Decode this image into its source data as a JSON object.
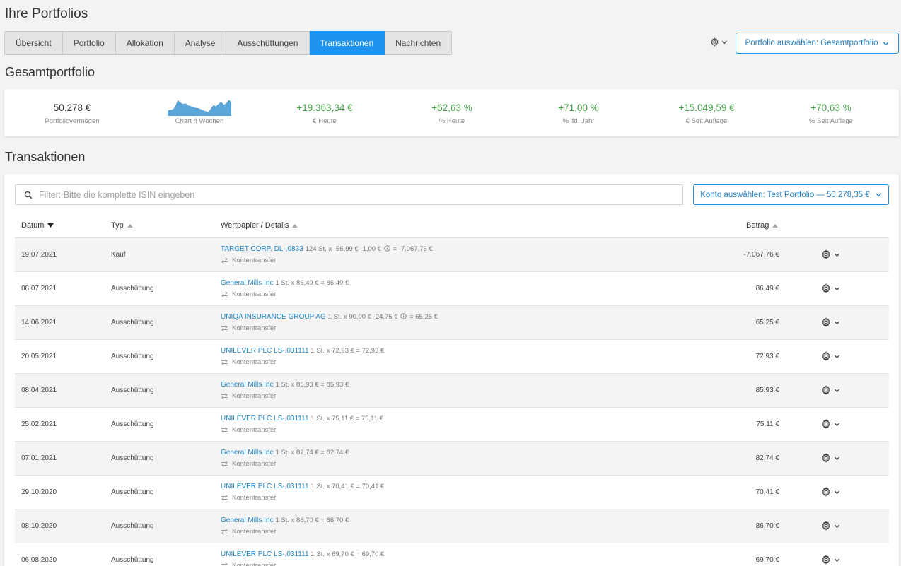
{
  "page": {
    "title": "Ihre Portfolios"
  },
  "tabs": [
    {
      "label": "Übersicht",
      "active": false
    },
    {
      "label": "Portfolio",
      "active": false
    },
    {
      "label": "Allokation",
      "active": false
    },
    {
      "label": "Analyse",
      "active": false
    },
    {
      "label": "Ausschüttungen",
      "active": false
    },
    {
      "label": "Transaktionen",
      "active": true
    },
    {
      "label": "Nachrichten",
      "active": false
    }
  ],
  "portfolio_select": {
    "label": "Portfolio auswählen: Gesamtportfolio"
  },
  "summary": {
    "title": "Gesamtportfolio",
    "value": "50.278 €",
    "value_label": "Portfoliovermögen",
    "chart_label": "Chart 4 Wochen",
    "kpis": [
      {
        "value": "+19.363,34  €",
        "label": "€ Heute"
      },
      {
        "value": "+62,63 %",
        "label": "% Heute"
      },
      {
        "value": "+71,00 %",
        "label": "% lfd. Jahr"
      },
      {
        "value": "+15.049,59  €",
        "label": "€ Seit Auflage"
      },
      {
        "value": "+70,63 %",
        "label": "% Seit Auflage"
      }
    ],
    "mini_chart": [
      30,
      34,
      36,
      52,
      90,
      78,
      68,
      72,
      60,
      56,
      50,
      46,
      44,
      38,
      30,
      26,
      20,
      40,
      62,
      54,
      68,
      82,
      64,
      70,
      92,
      80
    ]
  },
  "transactions": {
    "title": "Transaktionen",
    "filter_placeholder": "Filter: Bitte die komplette ISIN eingeben",
    "konto_select": "Konto auswählen: Test Portfolio — 50.278,35 €",
    "columns": {
      "date": "Datum",
      "typ": "Typ",
      "wp": "Wertpapier / Details",
      "betrag": "Betrag"
    },
    "rows": [
      {
        "date": "19.07.2021",
        "typ": "Kauf",
        "name": "TARGET CORP. DL-,0833",
        "detail_a": "124 St. x -56,99 € -1,00 €",
        "info": true,
        "detail_b": "= -7.067,76 €",
        "transfer": "Kontentransfer",
        "amount": "-7.067,76 €"
      },
      {
        "date": "08.07.2021",
        "typ": "Ausschüttung",
        "name": "General Mills Inc",
        "detail_a": "1 St. x 86,49 € = 86,49 €",
        "info": false,
        "detail_b": "",
        "transfer": "Kontentransfer",
        "amount": "86,49 €"
      },
      {
        "date": "14.06.2021",
        "typ": "Ausschüttung",
        "name": "UNIQA INSURANCE GROUP AG",
        "detail_a": "1 St. x 90,00 € -24,75 €",
        "info": true,
        "detail_b": "= 65,25 €",
        "transfer": "Kontentransfer",
        "amount": "65,25 €"
      },
      {
        "date": "20.05.2021",
        "typ": "Ausschüttung",
        "name": "UNILEVER PLC LS-,031111",
        "detail_a": "1 St. x 72,93 € = 72,93 €",
        "info": false,
        "detail_b": "",
        "transfer": "Kontentransfer",
        "amount": "72,93 €"
      },
      {
        "date": "08.04.2021",
        "typ": "Ausschüttung",
        "name": "General Mills Inc",
        "detail_a": "1 St. x 85,93 € = 85,93 €",
        "info": false,
        "detail_b": "",
        "transfer": "Kontentransfer",
        "amount": "85,93 €"
      },
      {
        "date": "25.02.2021",
        "typ": "Ausschüttung",
        "name": "UNILEVER PLC LS-,031111",
        "detail_a": "1 St. x 75,11 € = 75,11 €",
        "info": false,
        "detail_b": "",
        "transfer": "Kontentransfer",
        "amount": "75,11 €"
      },
      {
        "date": "07.01.2021",
        "typ": "Ausschüttung",
        "name": "General Mills Inc",
        "detail_a": "1 St. x 82,74 € = 82,74 €",
        "info": false,
        "detail_b": "",
        "transfer": "Kontentransfer",
        "amount": "82,74 €"
      },
      {
        "date": "29.10.2020",
        "typ": "Ausschüttung",
        "name": "UNILEVER PLC LS-,031111",
        "detail_a": "1 St. x 70,41 € = 70,41 €",
        "info": false,
        "detail_b": "",
        "transfer": "Kontentransfer",
        "amount": "70,41 €"
      },
      {
        "date": "08.10.2020",
        "typ": "Ausschüttung",
        "name": "General Mills Inc",
        "detail_a": "1 St. x 86,70 € = 86,70 €",
        "info": false,
        "detail_b": "",
        "transfer": "Kontentransfer",
        "amount": "86,70 €"
      },
      {
        "date": "06.08.2020",
        "typ": "Ausschüttung",
        "name": "UNILEVER PLC LS-,031111",
        "detail_a": "1 St. x 69,70 € = 69,70 €",
        "info": false,
        "detail_b": "",
        "transfer": "Kontentransfer",
        "amount": "69,70 €"
      }
    ]
  },
  "colors": {
    "accent": "#1e94f0",
    "link": "#2189cc",
    "positive": "#43a047",
    "chart_fill": "#5aa5da"
  },
  "icons": {
    "settings": "gear-icon",
    "dropdown": "chevron-down-icon",
    "search": "search-icon",
    "transfer": "transfer-icon",
    "info": "info-icon",
    "sort_desc": "sort-desc-icon",
    "sort_asc": "sort-asc-icon"
  }
}
